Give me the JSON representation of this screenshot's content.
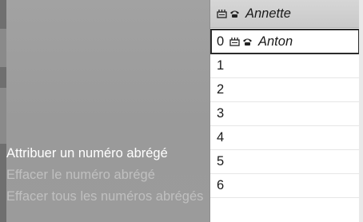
{
  "menu": {
    "items": [
      {
        "label": "Attribuer un numéro abrégé",
        "state": "active"
      },
      {
        "label": "Effacer le numéro abrégé",
        "state": "disabled"
      },
      {
        "label": "Effacer tous les numéros abrégés",
        "state": "disabled"
      }
    ]
  },
  "list": {
    "header": {
      "name": "Annette",
      "icons": [
        "phonebook-icon",
        "phone-icon"
      ]
    },
    "rows": [
      {
        "index": "0",
        "name": "Anton",
        "icons": [
          "phonebook-icon",
          "phone-icon"
        ],
        "selected": true
      },
      {
        "index": "1",
        "name": ""
      },
      {
        "index": "2",
        "name": ""
      },
      {
        "index": "3",
        "name": ""
      },
      {
        "index": "4",
        "name": ""
      },
      {
        "index": "5",
        "name": ""
      },
      {
        "index": "6",
        "name": ""
      }
    ]
  },
  "colors": {
    "menu_bg": "#9e9e9e",
    "menu_active_text": "#ffffff",
    "menu_disabled_text": "#c0c0c0",
    "list_bg": "#ffffff",
    "selection_border": "#2b2b2b"
  }
}
